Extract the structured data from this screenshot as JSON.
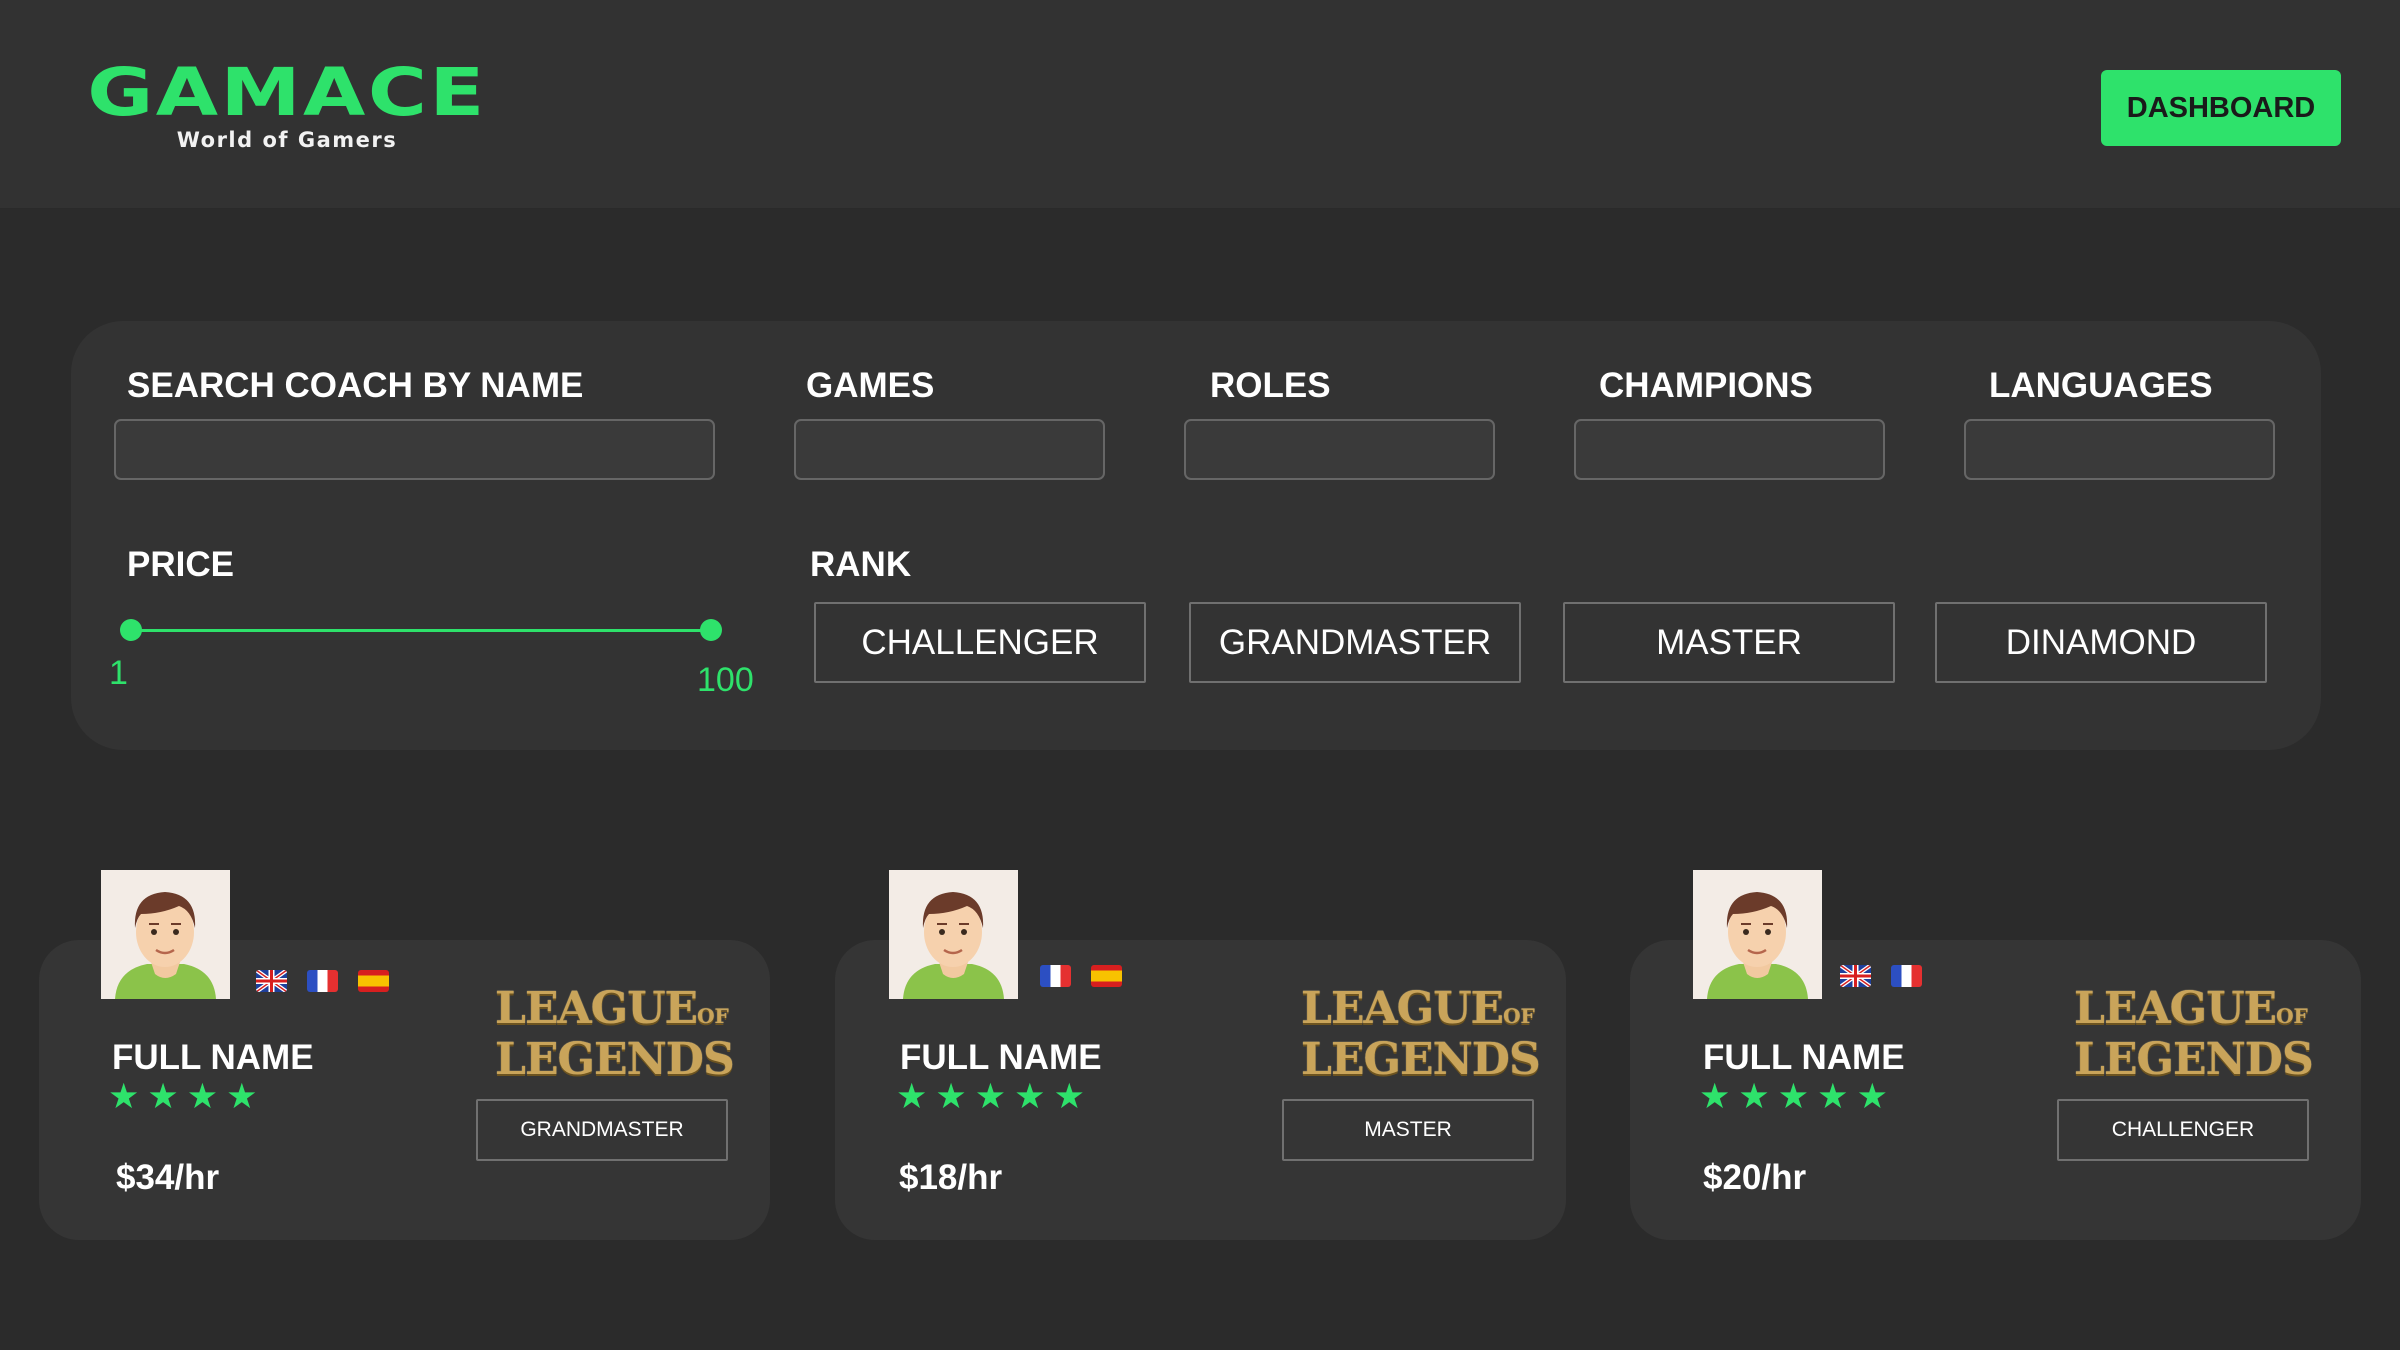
{
  "header": {
    "logo_title": "GAMACE",
    "logo_subtitle": "World of Gamers",
    "dashboard_label": "DASHBOARD"
  },
  "filters": {
    "search_label": "SEARCH COACH BY NAME",
    "search_value": "",
    "games_label": "GAMES",
    "games_value": "",
    "roles_label": "ROLES",
    "roles_value": "",
    "champions_label": "CHAMPIONS",
    "champions_value": "",
    "languages_label": "LANGUAGES",
    "languages_value": "",
    "price_label": "PRICE",
    "price_min": "1",
    "price_max": "100",
    "rank_label": "RANK",
    "ranks": [
      "CHALLENGER",
      "GRANDMASTER",
      "MASTER",
      "DINAMOND"
    ]
  },
  "colors": {
    "accent": "#2ee26b",
    "background": "#2b2b2b",
    "panel": "#333333"
  },
  "coaches": [
    {
      "name": "FULL NAME",
      "stars": 4,
      "price": "$34/hr",
      "rank": "GRANDMASTER",
      "languages": [
        "uk-flag-icon",
        "fr-flag-icon",
        "es-flag-icon"
      ],
      "game_logo_line1": "LEAGUE",
      "game_logo_of": "OF",
      "game_logo_line2": "LEGENDS"
    },
    {
      "name": "FULL NAME",
      "stars": 5,
      "price": "$18/hr",
      "rank": "MASTER",
      "languages": [
        "fr-flag-icon",
        "es-flag-icon"
      ],
      "game_logo_line1": "LEAGUE",
      "game_logo_of": "OF",
      "game_logo_line2": "LEGENDS"
    },
    {
      "name": "FULL NAME",
      "stars": 5,
      "price": "$20/hr",
      "rank": "CHALLENGER",
      "languages": [
        "uk-flag-icon",
        "fr-flag-icon"
      ],
      "game_logo_line1": "LEAGUE",
      "game_logo_of": "OF",
      "game_logo_line2": "LEGENDS"
    }
  ]
}
